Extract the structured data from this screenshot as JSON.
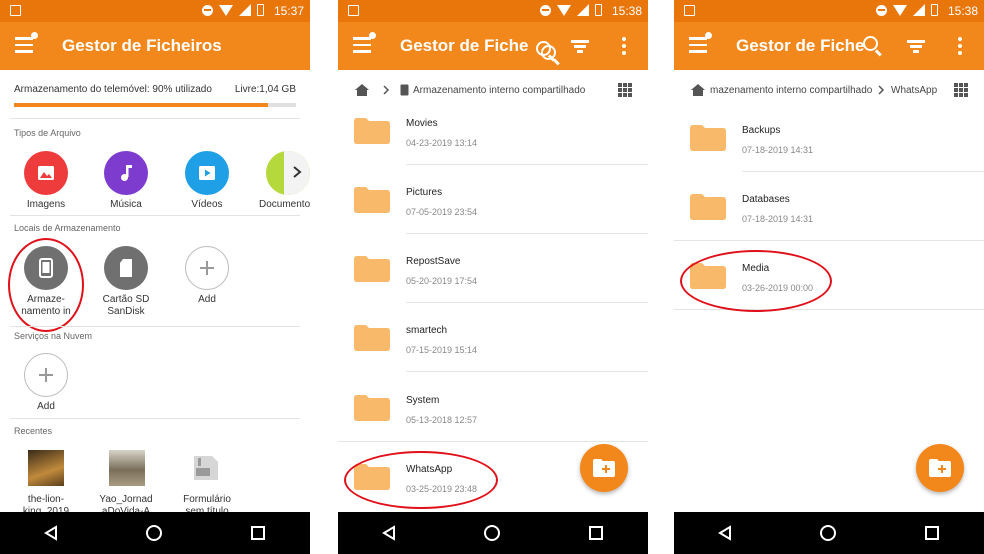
{
  "panel1": {
    "status_time": "15:37",
    "title": "Gestor de Ficheiros",
    "storage_label": "Armazenamento do telemóvel: 90% utilizado",
    "storage_free": "Livre:1,04 GB",
    "storage_used_fraction": 0.9,
    "file_types_label": "Tipos de Arquivo",
    "file_types": [
      {
        "label": "Imagens",
        "color": "#ee3b3b",
        "icon": "image-icon"
      },
      {
        "label": "Música",
        "color": "#7e3ccf",
        "icon": "music-icon"
      },
      {
        "label": "Vídeos",
        "color": "#1e9fe6",
        "icon": "video-icon"
      },
      {
        "label": "Documento",
        "color": "#b5d83c",
        "icon": "document-icon"
      }
    ],
    "storage_locations_label": "Locais de Armazenamento",
    "storage_locations": [
      {
        "label_line1": "Armaze-",
        "label_line2": "namento in",
        "icon": "phone-storage-icon"
      },
      {
        "label_line1": "Cartão SD",
        "label_line2": "SanDisk",
        "icon": "sd-card-icon"
      },
      {
        "label_line1": "Add",
        "label_line2": "",
        "icon": "add-icon"
      }
    ],
    "cloud_label": "Serviços na Nuvem",
    "cloud_add": "Add",
    "recent_label": "Recentes",
    "recent": [
      {
        "line1": "the-lion-",
        "line2": "king_2019"
      },
      {
        "line1": "Yao_Jornad",
        "line2": "aDoVida-A"
      },
      {
        "line1": "Formulário",
        "line2": "sem título"
      }
    ]
  },
  "panel2": {
    "status_time": "15:38",
    "title": "Gestor de Fiche",
    "breadcrumb": "Armazenamento interno compartilhado",
    "folders": [
      {
        "name": "Movies",
        "date": "04-23-2019 13:14"
      },
      {
        "name": "Pictures",
        "date": "07-05-2019 23:54"
      },
      {
        "name": "RepostSave",
        "date": "05-20-2019 17:54"
      },
      {
        "name": "smartech",
        "date": "07-15-2019 15:14"
      },
      {
        "name": "System",
        "date": "05-13-2018 12:57"
      },
      {
        "name": "WhatsApp",
        "date": "03-25-2019 23:48"
      }
    ]
  },
  "panel3": {
    "status_time": "15:38",
    "title": "Gestor de Fiche",
    "breadcrumb_1": "mazenamento interno compartilhado",
    "breadcrumb_2": "WhatsApp",
    "folders": [
      {
        "name": "Backups",
        "date": "07-18-2019 14:31"
      },
      {
        "name": "Databases",
        "date": "07-18-2019 14:31"
      },
      {
        "name": "Media",
        "date": "03-26-2019 00:00"
      }
    ]
  },
  "colors": {
    "accent": "#f2881b",
    "status_bar": "#e8760b",
    "folder": "#f8b96a",
    "highlight_ring": "#e0101a"
  }
}
